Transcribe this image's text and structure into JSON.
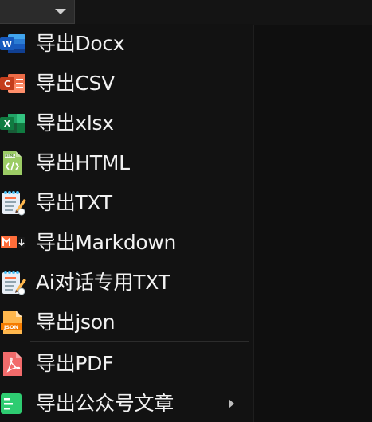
{
  "menu": {
    "items": [
      {
        "label": "导出Docx",
        "icon": "word-icon"
      },
      {
        "label": "导出CSV",
        "icon": "csv-icon"
      },
      {
        "label": "导出xlsx",
        "icon": "excel-icon"
      },
      {
        "label": "导出HTML",
        "icon": "html-file-icon"
      },
      {
        "label": "导出TXT",
        "icon": "txt-notepad-icon"
      },
      {
        "label": "导出Markdown",
        "icon": "markdown-icon"
      },
      {
        "label": "Ai对话专用TXT",
        "icon": "ai-txt-notepad-icon"
      },
      {
        "label": "导出json",
        "icon": "json-file-icon"
      },
      {
        "label": "导出PDF",
        "icon": "pdf-icon"
      },
      {
        "label": "导出公众号文章",
        "icon": "article-icon",
        "has_submenu": true
      }
    ]
  },
  "colors": {
    "background": "#121212",
    "text": "#f2f2f2",
    "word": "#2b579a",
    "csv": "#d24726",
    "excel": "#217346",
    "html": "#8bc34a",
    "markdown": "#ff5722",
    "json": "#f5a623",
    "pdf": "#f06262",
    "article": "#2ecc71"
  }
}
